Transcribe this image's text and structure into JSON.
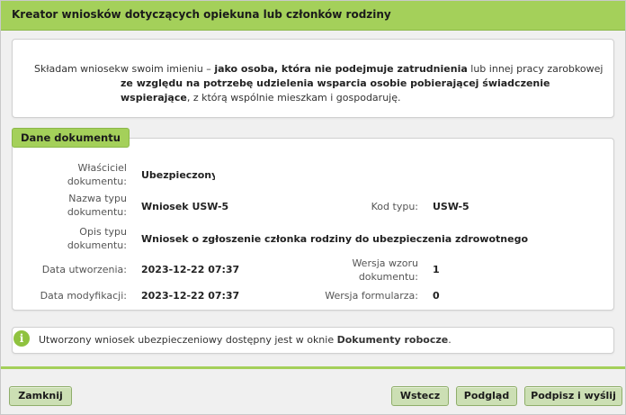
{
  "title": "Kreator wniosków dotyczących opiekuna lub członków rodziny",
  "declaration": {
    "label": "Składam wniosek",
    "text_1": "w swoim imieniu – ",
    "bold_1": "jako osoba, która nie podejmuje zatrudnienia",
    "text_2": " lub innej pracy zarobkowej ",
    "bold_2": "ze względu na potrzebę udzielenia wsparcia osobie pobierającej świadczenie wspierające",
    "text_3": ", z którą wspólnie mieszkam i gospodaruję."
  },
  "section_title": "Dane dokumentu",
  "fields": {
    "owner_label": "Właściciel dokumentu:",
    "owner_value": "Ubezpieczony",
    "type_name_label": "Nazwa typu dokumentu:",
    "type_name_value": "Wniosek USW-5",
    "type_code_label": "Kod typu:",
    "type_code_value": "USW-5",
    "type_desc_label": "Opis typu dokumentu:",
    "type_desc_value": "Wniosek o zgłoszenie członka rodziny do ubezpieczenia zdrowotnego",
    "created_label": "Data utworzenia:",
    "created_value": "2023-12-22 07:37",
    "template_version_label": "Wersja wzoru dokumentu:",
    "template_version_value": "1",
    "modified_label": "Data modyfikacji:",
    "modified_value": "2023-12-22 07:37",
    "form_version_label": "Wersja formularza:",
    "form_version_value": "0"
  },
  "info": {
    "icon": "info-icon",
    "text": "Utworzony wniosek ubezpieczeniowy dostępny jest w oknie ",
    "bold": "Dokumenty robocze",
    "end": "."
  },
  "buttons": {
    "close": "Zamknij",
    "back": "Wstecz",
    "preview": "Podgląd",
    "sign_send": "Podpisz i wyślij"
  },
  "colors": {
    "accent": "#a4d05a",
    "button": "#ccdfb4"
  }
}
